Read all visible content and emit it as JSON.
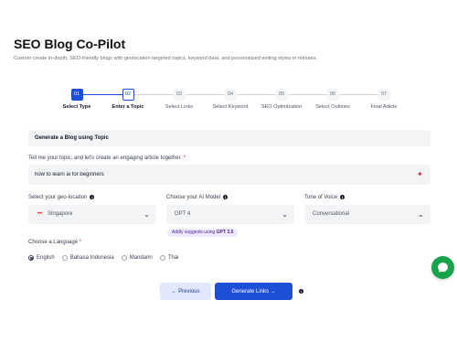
{
  "header": {
    "title": "SEO Blog Co-Pilot",
    "subtitle": "Custom create in-depth, SEO-friendly blogs with geolocation targeted topics, keyword data, and personalized writing styles in minutes."
  },
  "stepper": [
    {
      "num": "01",
      "label": "Select Type"
    },
    {
      "num": "02",
      "label": "Enter a Topic"
    },
    {
      "num": "03",
      "label": "Select Links"
    },
    {
      "num": "04",
      "label": "Select Keyword"
    },
    {
      "num": "05",
      "label": "SEO Optimization"
    },
    {
      "num": "06",
      "label": "Select Outlines"
    },
    {
      "num": "07",
      "label": "Final Article"
    }
  ],
  "section_title": "Generate a Blog using Topic",
  "topic": {
    "label": "Tell me your topic, and let's create an engaging article together.",
    "required_mark": "*",
    "value": "how to learn ai for beginners"
  },
  "geo": {
    "label": "Select your geo-location",
    "value": "Singapore"
  },
  "model": {
    "label": "Choose your AI Model",
    "value": "GPT 4",
    "suggest_prefix": "Addly suggests using",
    "suggest_model": "GPT 3.5"
  },
  "tone": {
    "label": "Tone of Voice",
    "value": "Conversational"
  },
  "language": {
    "label": "Choose a Language",
    "required_mark": "*",
    "options": [
      "English",
      "Bahasa Indonesia",
      "Mandarin",
      "Thai"
    ],
    "selected": "English"
  },
  "buttons": {
    "previous": "← Previous",
    "next": "Generate Links →"
  },
  "colors": {
    "accent": "#1d4ed8",
    "chat": "#16a34a"
  }
}
